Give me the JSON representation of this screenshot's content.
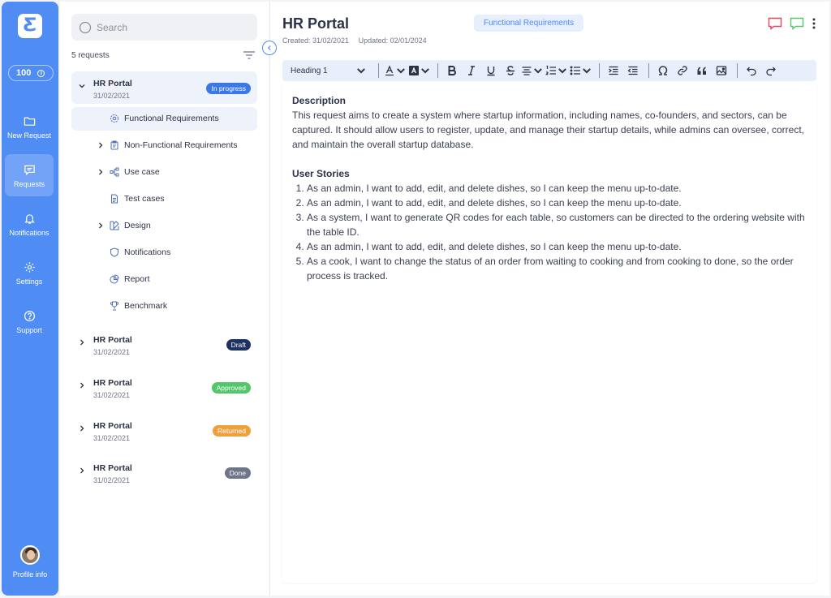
{
  "rail": {
    "credits": "100",
    "nav": [
      {
        "label": "New Request",
        "icon": "folder-icon"
      },
      {
        "label": "Requests",
        "icon": "chat-icon"
      },
      {
        "label": "Notifications",
        "icon": "bell-icon"
      },
      {
        "label": "Settings",
        "icon": "gear-icon"
      },
      {
        "label": "Support",
        "icon": "question-icon"
      }
    ],
    "profile_label": "Profile info"
  },
  "sidebar": {
    "search_placeholder": "Search",
    "count": "5 requests",
    "requests": [
      {
        "title": "HR Portal",
        "date": "31/02/2021",
        "status": "In progress",
        "color": "#3b78e7"
      },
      {
        "title": "HR Portal",
        "date": "31/02/2021",
        "status": "Draft",
        "color": "#1f3160"
      },
      {
        "title": "HR Portal",
        "date": "31/02/2021",
        "status": "Approved",
        "color": "#52c76a"
      },
      {
        "title": "HR Portal",
        "date": "31/02/2021",
        "status": "Returned",
        "color": "#eda03c"
      },
      {
        "title": "HR Portal",
        "date": "31/02/2021",
        "status": "Done",
        "color": "#6f7488"
      }
    ],
    "sections": [
      {
        "label": "Functional Requirements",
        "icon": "gear-icon"
      },
      {
        "label": "Non-Functional Requirements",
        "icon": "clipboard-icon"
      },
      {
        "label": "Use case",
        "icon": "flow-icon"
      },
      {
        "label": "Test cases",
        "icon": "document-icon"
      },
      {
        "label": "Design",
        "icon": "design-icon"
      },
      {
        "label": "Notifications",
        "icon": "shield-icon"
      },
      {
        "label": "Report",
        "icon": "pie-chart-icon"
      },
      {
        "label": "Benchmark",
        "icon": "trophy-icon"
      }
    ]
  },
  "main": {
    "title": "HR Portal",
    "created": "Created: 31/02/2021",
    "updated": "Updated: 02/01/2024",
    "section_pill": "Functional Requirements",
    "toolbar": {
      "heading": "Heading 1"
    },
    "description_heading": "Description",
    "description": "This request aims to create a system where startup information, including names, co-founders, and sectors, can be captured. It should allow users to register, update, and manage their startup details, while admins can oversee, correct, and maintain the overall startup database.",
    "stories_heading": "User Stories",
    "stories": [
      "As an admin, I want to add, edit, and delete dishes, so I can keep the menu up-to-date.",
      "As an admin, I want to add, edit, and delete dishes, so I can keep the menu up-to-date.",
      "As a system, I want to generate QR codes for each table, so customers can be directed to the ordering website with the table ID.",
      "As an admin, I want to add, edit, and delete dishes, so I can keep the menu up-to-date.",
      "As a cook, I want to change the status of an order from waiting to cooking and from cooking to done, so the order process is tracked."
    ]
  }
}
